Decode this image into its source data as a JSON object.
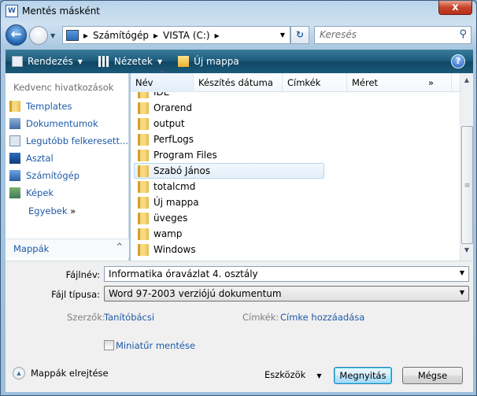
{
  "window": {
    "title": "Mentés másként",
    "close_label": "x"
  },
  "nav": {
    "breadcrumb": [
      "Számítógép",
      "VISTA (C:)"
    ],
    "search_placeholder": "Keresés"
  },
  "toolbar": {
    "organize": "Rendezés",
    "views": "Nézetek",
    "new_folder": "Új mappa",
    "help": "?"
  },
  "sidebar": {
    "header": "Kedvenc hivatkozások",
    "items": [
      {
        "label": "Templates",
        "icon": "folder-icon"
      },
      {
        "label": "Dokumentumok",
        "icon": "documents-icon"
      },
      {
        "label": "Legutóbb felkeresett...",
        "icon": "recent-icon"
      },
      {
        "label": "Asztal",
        "icon": "desktop-icon"
      },
      {
        "label": "Számítógép",
        "icon": "computer-icon"
      },
      {
        "label": "Képek",
        "icon": "pictures-icon"
      }
    ],
    "more": "Egyebek",
    "more_arrow": "»",
    "folders": "Mappák"
  },
  "list": {
    "columns": [
      "Név",
      "Készítés dátuma",
      "Címkék",
      "Méret"
    ],
    "overflow": "»",
    "rows": [
      "IDE",
      "Orarend",
      "output",
      "PerfLogs",
      "Program Files",
      "Szabó János",
      "totalcmd",
      "Új mappa",
      "üveges",
      "wamp",
      "Windows"
    ],
    "selected": "Szabó János"
  },
  "form": {
    "filename_label": "Fájlnév:",
    "filename": "Informatika óravázlat 4. osztály",
    "filetype_label": "Fájl típusa:",
    "filetype": "Word 97-2003 verziójú dokumentum",
    "authors_label": "Szerzők:",
    "authors": "Tanítóbácsi",
    "tags_label": "Címkék:",
    "tags": "Címke hozzáadása",
    "thumbnail_label": "Miniatűr mentése",
    "thumbnail_checked": false
  },
  "footer": {
    "hide_folders": "Mappák elrejtése",
    "tools": "Eszközök",
    "open": "Megnyitás",
    "cancel": "Mégse"
  }
}
